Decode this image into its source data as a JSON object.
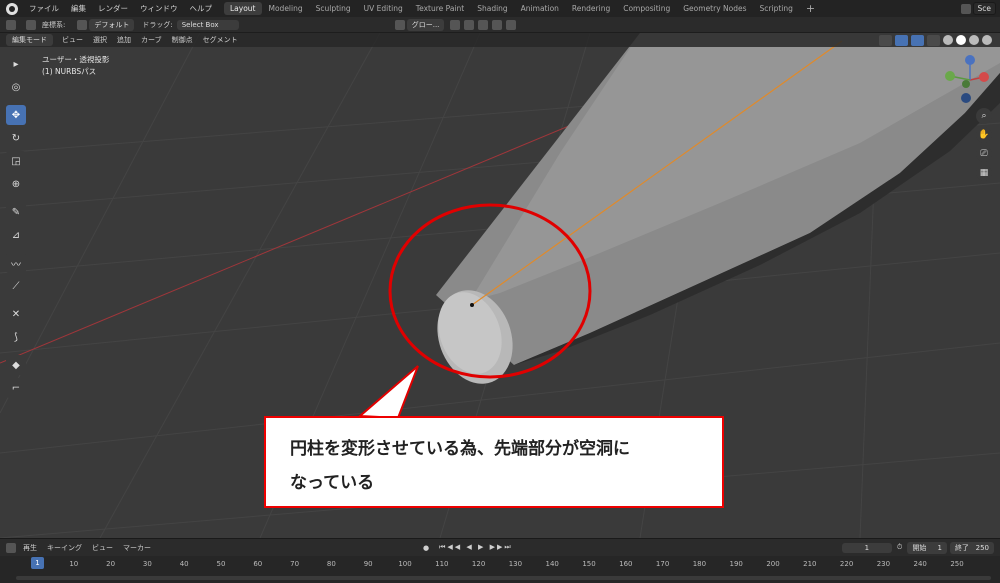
{
  "topbar": {
    "menus": [
      "ファイル",
      "編集",
      "レンダー",
      "ウィンドウ",
      "ヘルプ"
    ],
    "workspaces": [
      "Layout",
      "Modeling",
      "Sculpting",
      "UV Editing",
      "Texture Paint",
      "Shading",
      "Animation",
      "Rendering",
      "Compositing",
      "Geometry Nodes",
      "Scripting"
    ],
    "active_workspace": "Layout",
    "add_tab": "+",
    "scene": "Sce"
  },
  "toolheader": {
    "coord_label": "座標系:",
    "pivot_drop": "デフォルト",
    "drag_label": "ドラッグ:",
    "drag_drop": "Select Box",
    "transform_drop": "グロー..."
  },
  "modeheader": {
    "mode": "編集モード",
    "menus": [
      "ビュー",
      "選択",
      "追加",
      "カーブ",
      "制御点",
      "セグメント"
    ]
  },
  "view_info": {
    "line1": "ユーザー・透視投影",
    "line2": "(1) NURBSパス"
  },
  "callout": {
    "line1": "円柱を変形させている為、先端部分が空洞に",
    "line2": "なっている"
  },
  "timeline": {
    "menus": [
      "再生",
      "キーイング",
      "ビュー",
      "マーカー"
    ],
    "current_frame": "1",
    "start_label": "開始",
    "start_value": "1",
    "end_label": "終了",
    "end_value": "250",
    "ticks": [
      "1",
      "10",
      "20",
      "30",
      "40",
      "50",
      "60",
      "70",
      "80",
      "90",
      "100",
      "110",
      "120",
      "130",
      "140",
      "150",
      "160",
      "170",
      "180",
      "190",
      "200",
      "210",
      "220",
      "230",
      "240",
      "250"
    ]
  },
  "colors": {
    "accent": "#4772b3",
    "callout_border": "#e00000",
    "curve_line": "#e08a2a"
  }
}
